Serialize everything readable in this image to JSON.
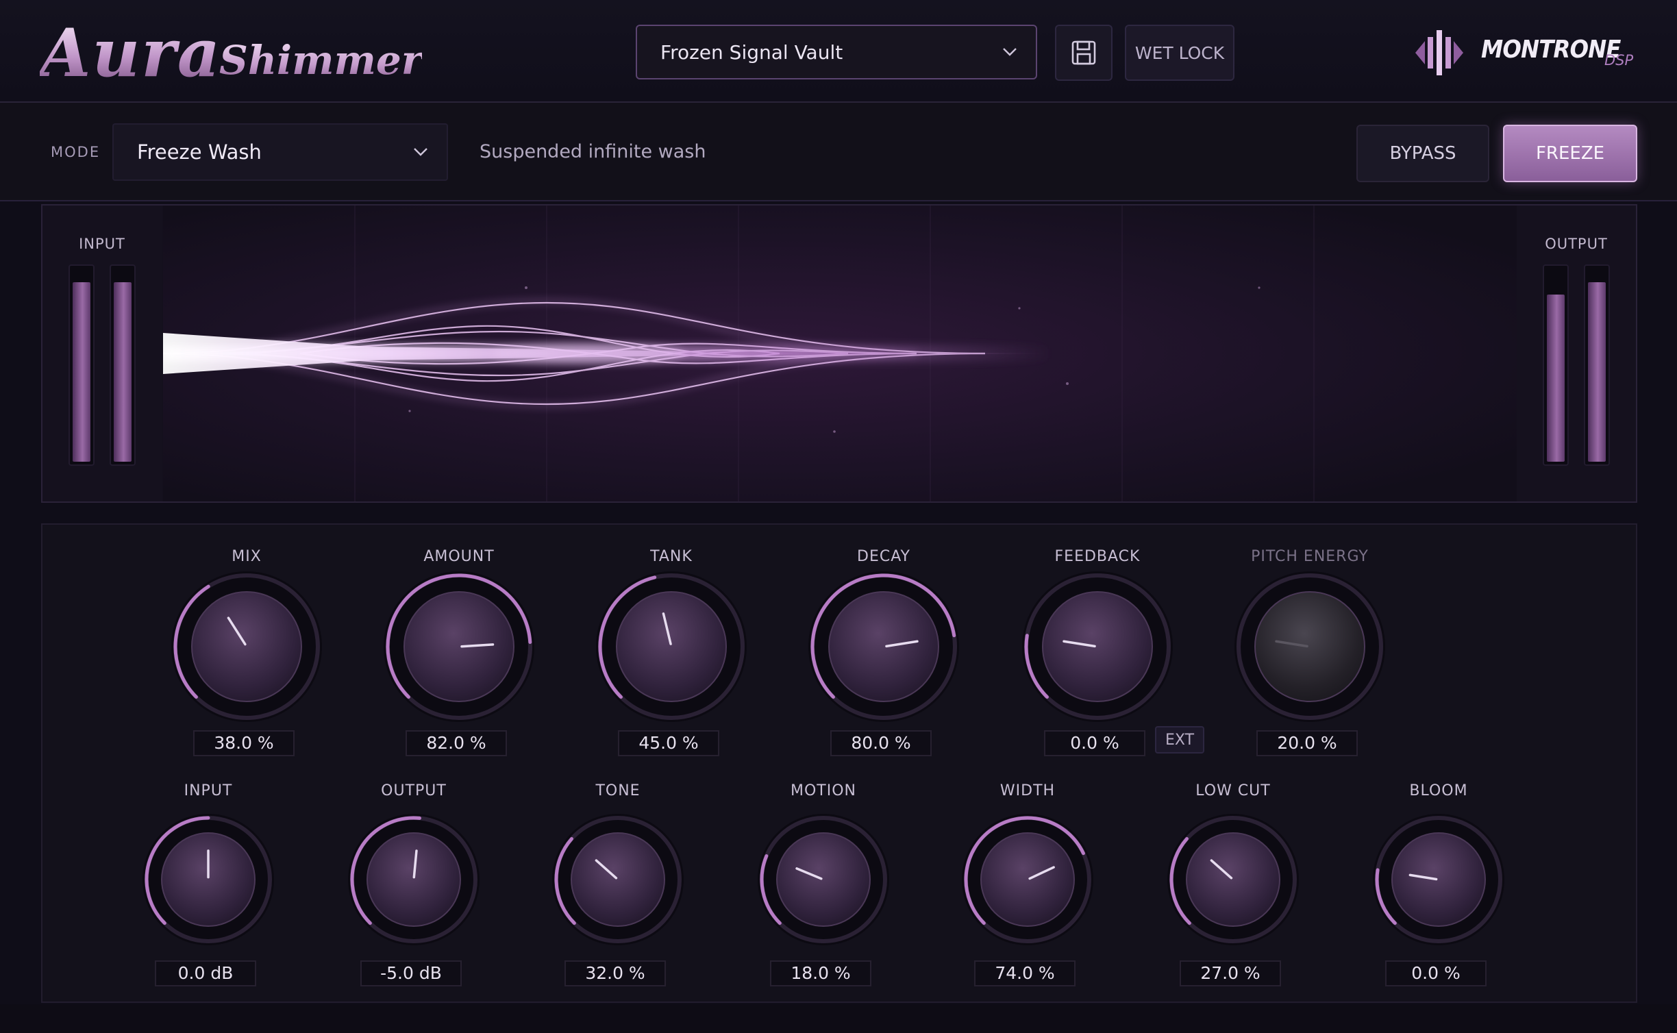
{
  "header": {
    "logo_main": "Aura",
    "logo_sub": "Shimmer",
    "preset_name": "Frozen Signal Vault",
    "wet_lock_label": "WET LOCK",
    "brand_name": "MONTRONE",
    "brand_suffix": "DSP"
  },
  "mode_bar": {
    "label": "MODE",
    "mode_value": "Freeze Wash",
    "description": "Suspended infinite wash",
    "bypass_label": "BYPASS",
    "freeze_label": "FREEZE",
    "freeze_active": true
  },
  "visualizer": {
    "input_label": "INPUT",
    "output_label": "OUTPUT",
    "input_levels": [
      0.93,
      0.93
    ],
    "output_levels": [
      0.87,
      0.93
    ]
  },
  "knobs_row1": [
    {
      "label": "MIX",
      "value": "38.0 %",
      "fraction": 0.38
    },
    {
      "label": "AMOUNT",
      "value": "82.0 %",
      "fraction": 0.82
    },
    {
      "label": "TANK",
      "value": "45.0 %",
      "fraction": 0.45
    },
    {
      "label": "DECAY",
      "value": "80.0 %",
      "fraction": 0.8
    },
    {
      "label": "FEEDBACK",
      "value": "0.0 %",
      "fraction": 0.2
    },
    {
      "label": "PITCH ENERGY",
      "value": "20.0 %",
      "fraction": 0.2,
      "disabled": true
    }
  ],
  "ext_label": "EXT",
  "knobs_row2": [
    {
      "label": "INPUT",
      "value": "0.0 dB",
      "fraction": 0.5
    },
    {
      "label": "OUTPUT",
      "value": "-5.0 dB",
      "fraction": 0.52
    },
    {
      "label": "TONE",
      "value": "32.0 %",
      "fraction": 0.32
    },
    {
      "label": "MOTION",
      "value": "18.0 %",
      "fraction": 0.25
    },
    {
      "label": "WIDTH",
      "value": "74.0 %",
      "fraction": 0.74
    },
    {
      "label": "LOW CUT",
      "value": "27.0 %",
      "fraction": 0.32
    },
    {
      "label": "BLOOM",
      "value": "0.0 %",
      "fraction": 0.2
    }
  ],
  "colors": {
    "accent": "#b07fc0",
    "arc": "#b87cc6",
    "knob_body": "#3a2a45",
    "background": "#0f0d18"
  }
}
